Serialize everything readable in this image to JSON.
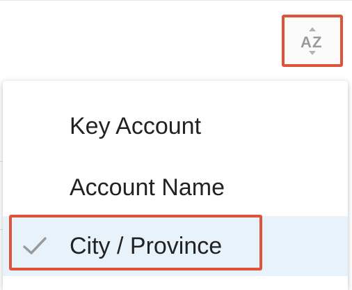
{
  "toolbar": {
    "sort_icon": "sort-az-icon",
    "sort_icon_text_a": "A",
    "sort_icon_text_z": "Z"
  },
  "sort_menu": {
    "items": [
      {
        "label": "Key Account",
        "selected": false
      },
      {
        "label": "Account Name",
        "selected": false
      },
      {
        "label": "City / Province",
        "selected": true,
        "icon": "check-icon"
      }
    ]
  },
  "colors": {
    "highlight": "#e0533b",
    "selected_bg": "#e8f2fb",
    "icon_gray": "#9a9a9a",
    "text": "#222222"
  }
}
